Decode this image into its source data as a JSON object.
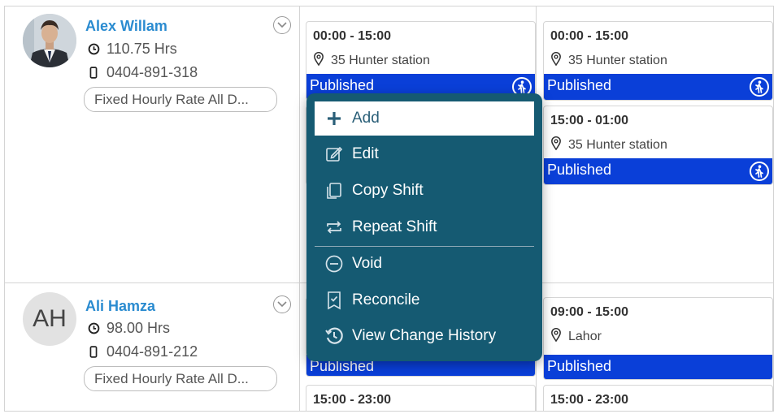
{
  "employees": [
    {
      "name": "Alex Willam",
      "hours": "110.75 Hrs",
      "phone": "0404-891-318",
      "rate": "Fixed Hourly Rate All D...",
      "avatar": "photo"
    },
    {
      "name": "Ali Hamza",
      "initials": "AH",
      "hours": "98.00 Hrs",
      "phone": "0404-891-212",
      "rate": "Fixed Hourly Rate All D..."
    }
  ],
  "shifts": {
    "s1": {
      "time": "00:00 - 15:00",
      "location": "35 Hunter station",
      "status": "Published"
    },
    "s2": {
      "time": "00:00 - 15:00",
      "location": "35 Hunter station",
      "status": "Published"
    },
    "s3": {
      "time": "15:00 - 01:00",
      "location": "35 Hunter station",
      "status": "Published"
    },
    "s4": {
      "status": "Published"
    },
    "s5": {
      "time": "09:00 - 15:00",
      "location": "Lahor",
      "status": "Published"
    },
    "s6": {
      "time": "15:00 - 23:00"
    },
    "s7": {
      "time": "15:00 - 23:00"
    }
  },
  "context_menu": {
    "items": [
      {
        "label": "Add",
        "icon": "plus-icon"
      },
      {
        "label": "Edit",
        "icon": "edit-icon"
      },
      {
        "label": "Copy Shift",
        "icon": "copy-icon"
      },
      {
        "label": "Repeat Shift",
        "icon": "repeat-icon"
      },
      {
        "label": "Void",
        "icon": "void-icon"
      },
      {
        "label": "Reconcile",
        "icon": "reconcile-icon"
      },
      {
        "label": "View Change History",
        "icon": "history-icon"
      }
    ]
  },
  "colors": {
    "published": "#0a3fd8",
    "menu_bg": "#155a72",
    "name": "#2a8bd0"
  }
}
